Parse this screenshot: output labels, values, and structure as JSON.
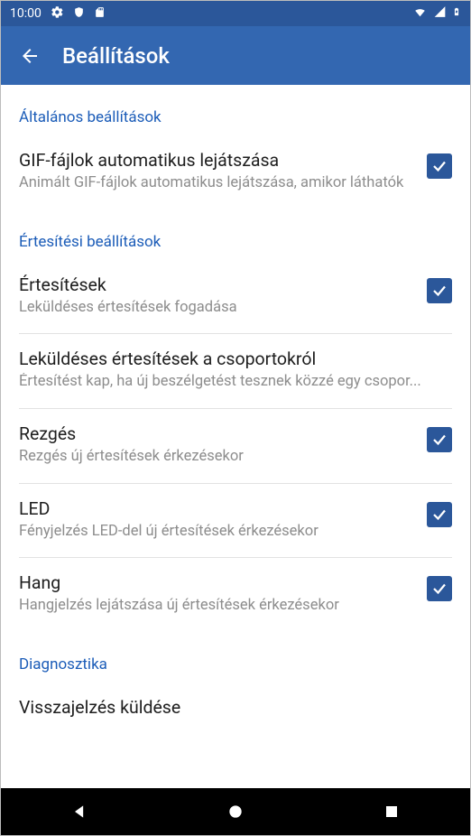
{
  "statusbar": {
    "time": "10:00"
  },
  "appbar": {
    "title": "Beállítások"
  },
  "sections": {
    "general": {
      "header": "Általános beállítások",
      "gif": {
        "title": "GIF-fájlok automatikus lejátszása",
        "sub": "Animált GIF-fájlok automatikus lejátszása, amikor láthatók"
      }
    },
    "notifications": {
      "header": "Értesítési beállítások",
      "notify": {
        "title": "Értesítések",
        "sub": "Leküldéses értesítések fogadása"
      },
      "groups": {
        "title": "Leküldéses értesítések a csoportokról",
        "sub": "Értesítést kap, ha új beszélgetést tesznek közzé egy csopor..."
      },
      "vibrate": {
        "title": "Rezgés",
        "sub": "Rezgés új értesítések érkezésekor"
      },
      "led": {
        "title": "LED",
        "sub": "Fényjelzés LED-del új értesítések érkezésekor"
      },
      "sound": {
        "title": "Hang",
        "sub": "Hangjelzés lejátszása új értesítések érkezésekor"
      }
    },
    "diagnostics": {
      "header": "Diagnosztika",
      "feedback": {
        "title": "Visszajelzés küldése"
      }
    }
  }
}
